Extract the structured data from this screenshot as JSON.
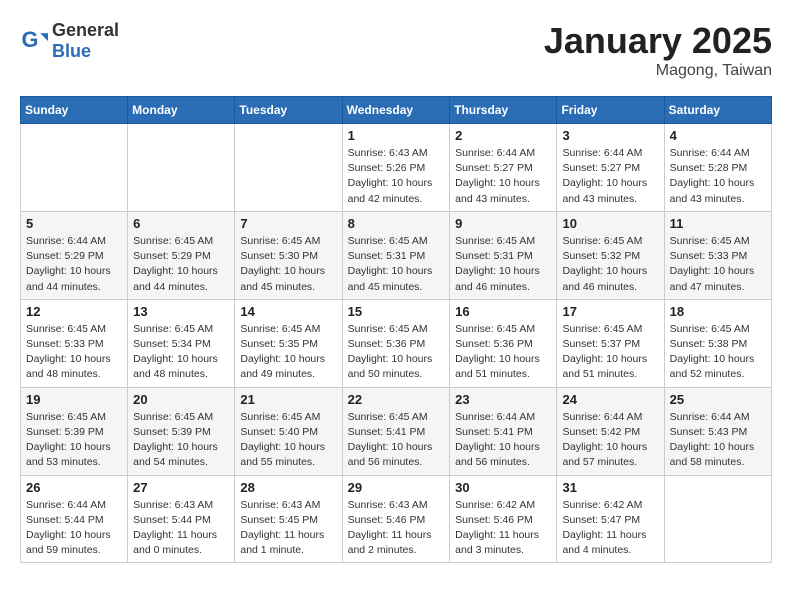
{
  "header": {
    "logo_general": "General",
    "logo_blue": "Blue",
    "title": "January 2025",
    "location": "Magong, Taiwan"
  },
  "weekdays": [
    "Sunday",
    "Monday",
    "Tuesday",
    "Wednesday",
    "Thursday",
    "Friday",
    "Saturday"
  ],
  "weeks": [
    [
      {
        "day": "",
        "info": ""
      },
      {
        "day": "",
        "info": ""
      },
      {
        "day": "",
        "info": ""
      },
      {
        "day": "1",
        "info": "Sunrise: 6:43 AM\nSunset: 5:26 PM\nDaylight: 10 hours\nand 42 minutes."
      },
      {
        "day": "2",
        "info": "Sunrise: 6:44 AM\nSunset: 5:27 PM\nDaylight: 10 hours\nand 43 minutes."
      },
      {
        "day": "3",
        "info": "Sunrise: 6:44 AM\nSunset: 5:27 PM\nDaylight: 10 hours\nand 43 minutes."
      },
      {
        "day": "4",
        "info": "Sunrise: 6:44 AM\nSunset: 5:28 PM\nDaylight: 10 hours\nand 43 minutes."
      }
    ],
    [
      {
        "day": "5",
        "info": "Sunrise: 6:44 AM\nSunset: 5:29 PM\nDaylight: 10 hours\nand 44 minutes."
      },
      {
        "day": "6",
        "info": "Sunrise: 6:45 AM\nSunset: 5:29 PM\nDaylight: 10 hours\nand 44 minutes."
      },
      {
        "day": "7",
        "info": "Sunrise: 6:45 AM\nSunset: 5:30 PM\nDaylight: 10 hours\nand 45 minutes."
      },
      {
        "day": "8",
        "info": "Sunrise: 6:45 AM\nSunset: 5:31 PM\nDaylight: 10 hours\nand 45 minutes."
      },
      {
        "day": "9",
        "info": "Sunrise: 6:45 AM\nSunset: 5:31 PM\nDaylight: 10 hours\nand 46 minutes."
      },
      {
        "day": "10",
        "info": "Sunrise: 6:45 AM\nSunset: 5:32 PM\nDaylight: 10 hours\nand 46 minutes."
      },
      {
        "day": "11",
        "info": "Sunrise: 6:45 AM\nSunset: 5:33 PM\nDaylight: 10 hours\nand 47 minutes."
      }
    ],
    [
      {
        "day": "12",
        "info": "Sunrise: 6:45 AM\nSunset: 5:33 PM\nDaylight: 10 hours\nand 48 minutes."
      },
      {
        "day": "13",
        "info": "Sunrise: 6:45 AM\nSunset: 5:34 PM\nDaylight: 10 hours\nand 48 minutes."
      },
      {
        "day": "14",
        "info": "Sunrise: 6:45 AM\nSunset: 5:35 PM\nDaylight: 10 hours\nand 49 minutes."
      },
      {
        "day": "15",
        "info": "Sunrise: 6:45 AM\nSunset: 5:36 PM\nDaylight: 10 hours\nand 50 minutes."
      },
      {
        "day": "16",
        "info": "Sunrise: 6:45 AM\nSunset: 5:36 PM\nDaylight: 10 hours\nand 51 minutes."
      },
      {
        "day": "17",
        "info": "Sunrise: 6:45 AM\nSunset: 5:37 PM\nDaylight: 10 hours\nand 51 minutes."
      },
      {
        "day": "18",
        "info": "Sunrise: 6:45 AM\nSunset: 5:38 PM\nDaylight: 10 hours\nand 52 minutes."
      }
    ],
    [
      {
        "day": "19",
        "info": "Sunrise: 6:45 AM\nSunset: 5:39 PM\nDaylight: 10 hours\nand 53 minutes."
      },
      {
        "day": "20",
        "info": "Sunrise: 6:45 AM\nSunset: 5:39 PM\nDaylight: 10 hours\nand 54 minutes."
      },
      {
        "day": "21",
        "info": "Sunrise: 6:45 AM\nSunset: 5:40 PM\nDaylight: 10 hours\nand 55 minutes."
      },
      {
        "day": "22",
        "info": "Sunrise: 6:45 AM\nSunset: 5:41 PM\nDaylight: 10 hours\nand 56 minutes."
      },
      {
        "day": "23",
        "info": "Sunrise: 6:44 AM\nSunset: 5:41 PM\nDaylight: 10 hours\nand 56 minutes."
      },
      {
        "day": "24",
        "info": "Sunrise: 6:44 AM\nSunset: 5:42 PM\nDaylight: 10 hours\nand 57 minutes."
      },
      {
        "day": "25",
        "info": "Sunrise: 6:44 AM\nSunset: 5:43 PM\nDaylight: 10 hours\nand 58 minutes."
      }
    ],
    [
      {
        "day": "26",
        "info": "Sunrise: 6:44 AM\nSunset: 5:44 PM\nDaylight: 10 hours\nand 59 minutes."
      },
      {
        "day": "27",
        "info": "Sunrise: 6:43 AM\nSunset: 5:44 PM\nDaylight: 11 hours\nand 0 minutes."
      },
      {
        "day": "28",
        "info": "Sunrise: 6:43 AM\nSunset: 5:45 PM\nDaylight: 11 hours\nand 1 minute."
      },
      {
        "day": "29",
        "info": "Sunrise: 6:43 AM\nSunset: 5:46 PM\nDaylight: 11 hours\nand 2 minutes."
      },
      {
        "day": "30",
        "info": "Sunrise: 6:42 AM\nSunset: 5:46 PM\nDaylight: 11 hours\nand 3 minutes."
      },
      {
        "day": "31",
        "info": "Sunrise: 6:42 AM\nSunset: 5:47 PM\nDaylight: 11 hours\nand 4 minutes."
      },
      {
        "day": "",
        "info": ""
      }
    ]
  ]
}
